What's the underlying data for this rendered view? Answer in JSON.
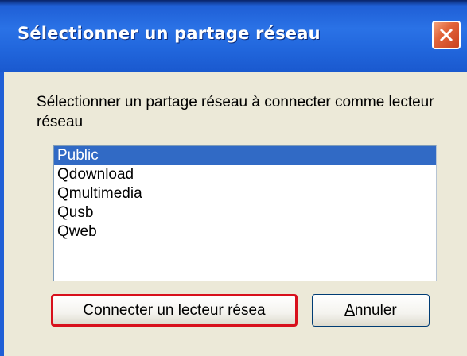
{
  "window": {
    "title": "Sélectionner un partage réseau",
    "colors": {
      "titlebar": "#2166dc",
      "background": "#ece9d8",
      "selection": "#316ac5",
      "highlight_border": "#d8101c",
      "close_button": "#e2643a"
    },
    "close_icon": "close-icon"
  },
  "dialog": {
    "instruction": "Sélectionner un partage réseau à connecter comme lecteur réseau",
    "list": {
      "items": [
        {
          "label": "Public",
          "selected": true
        },
        {
          "label": "Qdownload",
          "selected": false
        },
        {
          "label": "Qmultimedia",
          "selected": false
        },
        {
          "label": "Qusb",
          "selected": false
        },
        {
          "label": "Qweb",
          "selected": false
        }
      ]
    },
    "buttons": {
      "connect_label": "Connecter un lecteur résea",
      "cancel_label_first": "A",
      "cancel_label_rest": "nnuler"
    }
  }
}
